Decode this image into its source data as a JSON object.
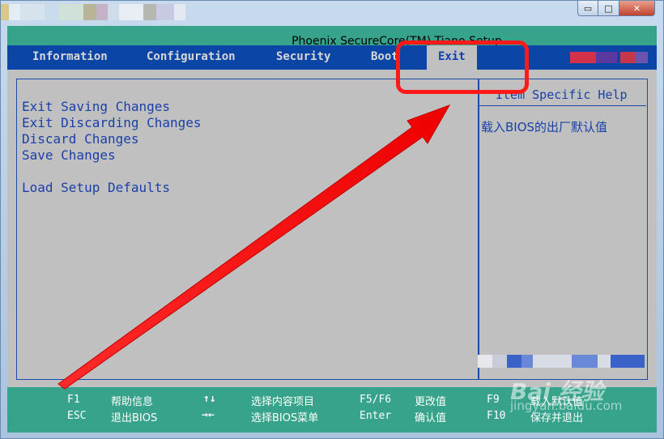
{
  "window": {
    "min_icon": "minimize-icon",
    "max_icon": "maximize-icon",
    "close_icon": "close-icon",
    "min_glyph": "▭",
    "max_glyph": "□",
    "close_glyph": "✕"
  },
  "bios": {
    "title": "Phoenix SecureCore(TM) Tiano Setup",
    "menu": [
      {
        "label": "Information"
      },
      {
        "label": "Configuration"
      },
      {
        "label": "Security"
      },
      {
        "label": "Boot"
      },
      {
        "label": "Exit",
        "active": true
      }
    ],
    "options": [
      "Exit Saving Changes",
      "Exit Discarding Changes",
      "Discard Changes",
      "Save Changes",
      "Load Setup Defaults"
    ],
    "help": {
      "title": "Item Specific Help",
      "text": "载入BIOS的出厂默认值"
    },
    "keys": [
      {
        "key": "F1",
        "desc": "帮助信息"
      },
      {
        "key": "ESC",
        "desc": "退出BIOS"
      },
      {
        "key": "↑↓",
        "desc": "选择内容项目"
      },
      {
        "key": "→←",
        "desc": "选择BIOS菜单"
      },
      {
        "key": "F5/F6",
        "desc": "更改值"
      },
      {
        "key": "Enter",
        "desc": "确认值"
      },
      {
        "key": "F9",
        "desc": "载入默认值"
      },
      {
        "key": "F10",
        "desc": "保存并退出"
      }
    ]
  },
  "watermark": {
    "main": "Bai 经验",
    "sub": "jingyan.baidu.com"
  },
  "colors": {
    "teal": "#36a38a",
    "menu_blue": "#0b45a6",
    "text_blue": "#1a3fa8",
    "screen_gray": "#c0c0c0",
    "annotation_red": "#ff1a1a"
  }
}
